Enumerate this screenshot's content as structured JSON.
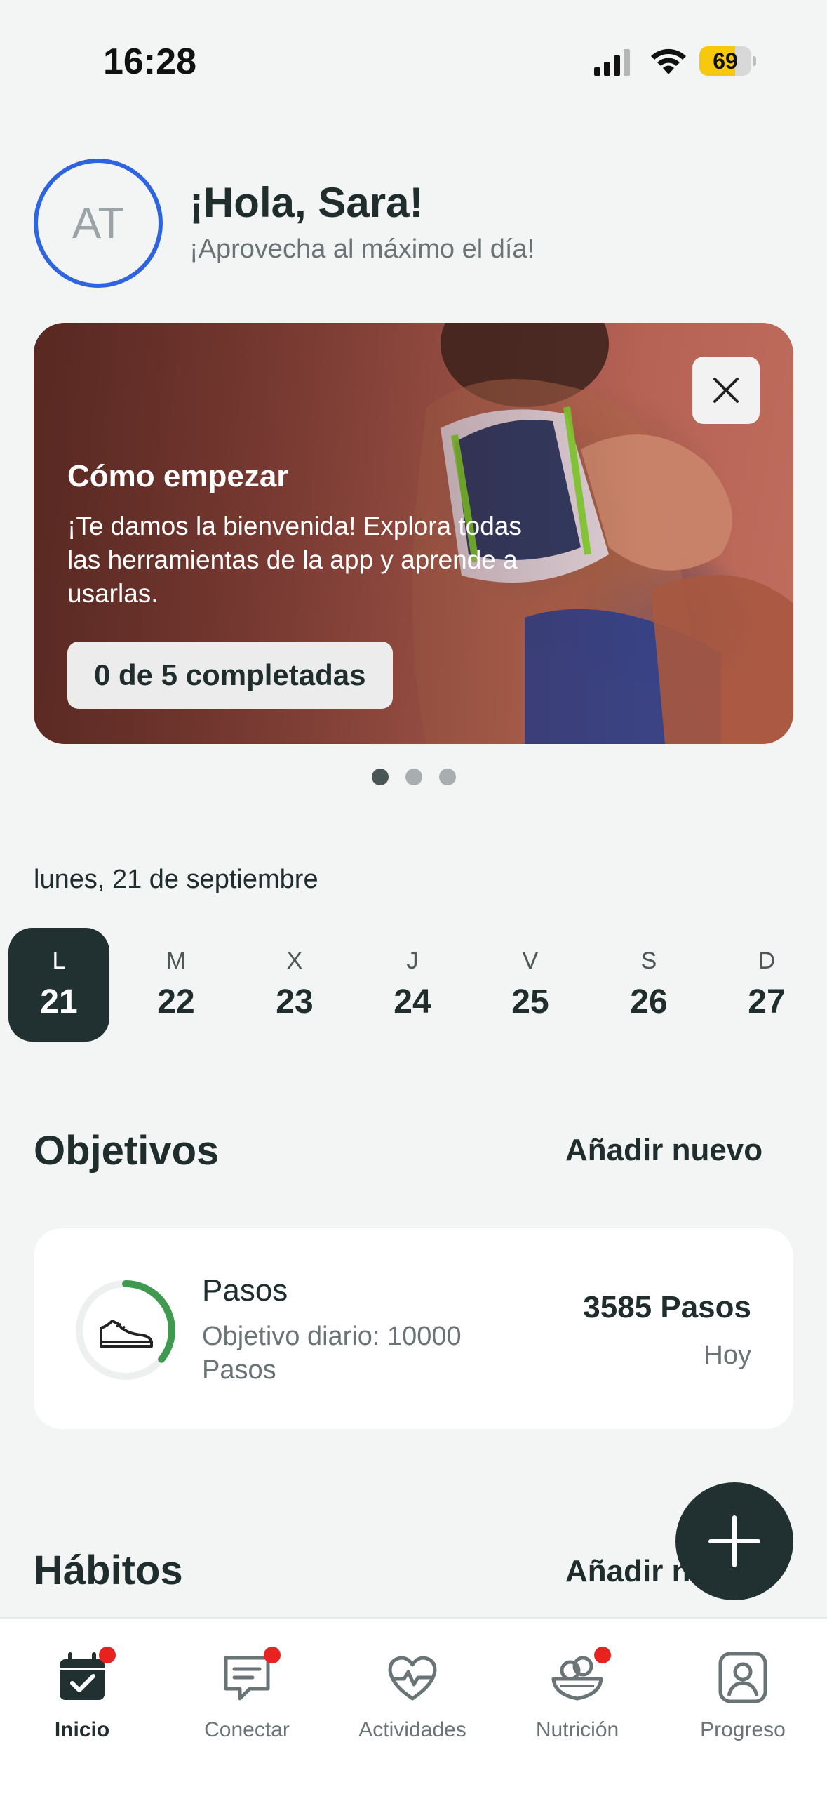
{
  "status_bar": {
    "time": "16:28",
    "battery": "69",
    "battery_level": 0.69
  },
  "greeting": {
    "avatar_initials": "AT",
    "title": "¡Hola, Sara!",
    "subtitle": "¡Aprovecha al máximo el día!"
  },
  "banner": {
    "title": "Cómo empezar",
    "text": "¡Te damos la bienvenida! Explora todas las herramientas de la app y aprende a usarlas.",
    "button": "0 de 5 completadas",
    "page_count": 3,
    "active_page": 1
  },
  "date_label": "lunes, 21 de septiembre",
  "week": [
    {
      "letter": "L",
      "num": "21",
      "active": true
    },
    {
      "letter": "M",
      "num": "22"
    },
    {
      "letter": "X",
      "num": "23"
    },
    {
      "letter": "J",
      "num": "24"
    },
    {
      "letter": "V",
      "num": "25"
    },
    {
      "letter": "S",
      "num": "26"
    },
    {
      "letter": "D",
      "num": "27"
    }
  ],
  "objectives": {
    "title": "Objetivos",
    "action": "Añadir nuevo",
    "goal": {
      "title": "Pasos",
      "subtitle": "Objetivo diario: 10000 Pasos",
      "value": "3585 Pasos",
      "when": "Hoy",
      "progress": 0.3585,
      "icon": "sneaker-icon"
    }
  },
  "habits": {
    "title": "Hábitos",
    "action": "Añadir nuevo"
  },
  "colors": {
    "accent": "#213030",
    "ring": "#3f9a4f",
    "avatar_border": "#2f64e0",
    "badge": "#e8231f"
  },
  "nav": [
    {
      "label": "Inicio",
      "icon": "calendar-check-icon",
      "active": true,
      "badge": true
    },
    {
      "label": "Conectar",
      "icon": "chat-icon",
      "badge": true
    },
    {
      "label": "Actividades",
      "icon": "heartbeat-icon"
    },
    {
      "label": "Nutrición",
      "icon": "salad-bowl-icon",
      "badge": true
    },
    {
      "label": "Progreso",
      "icon": "profile-icon"
    }
  ]
}
